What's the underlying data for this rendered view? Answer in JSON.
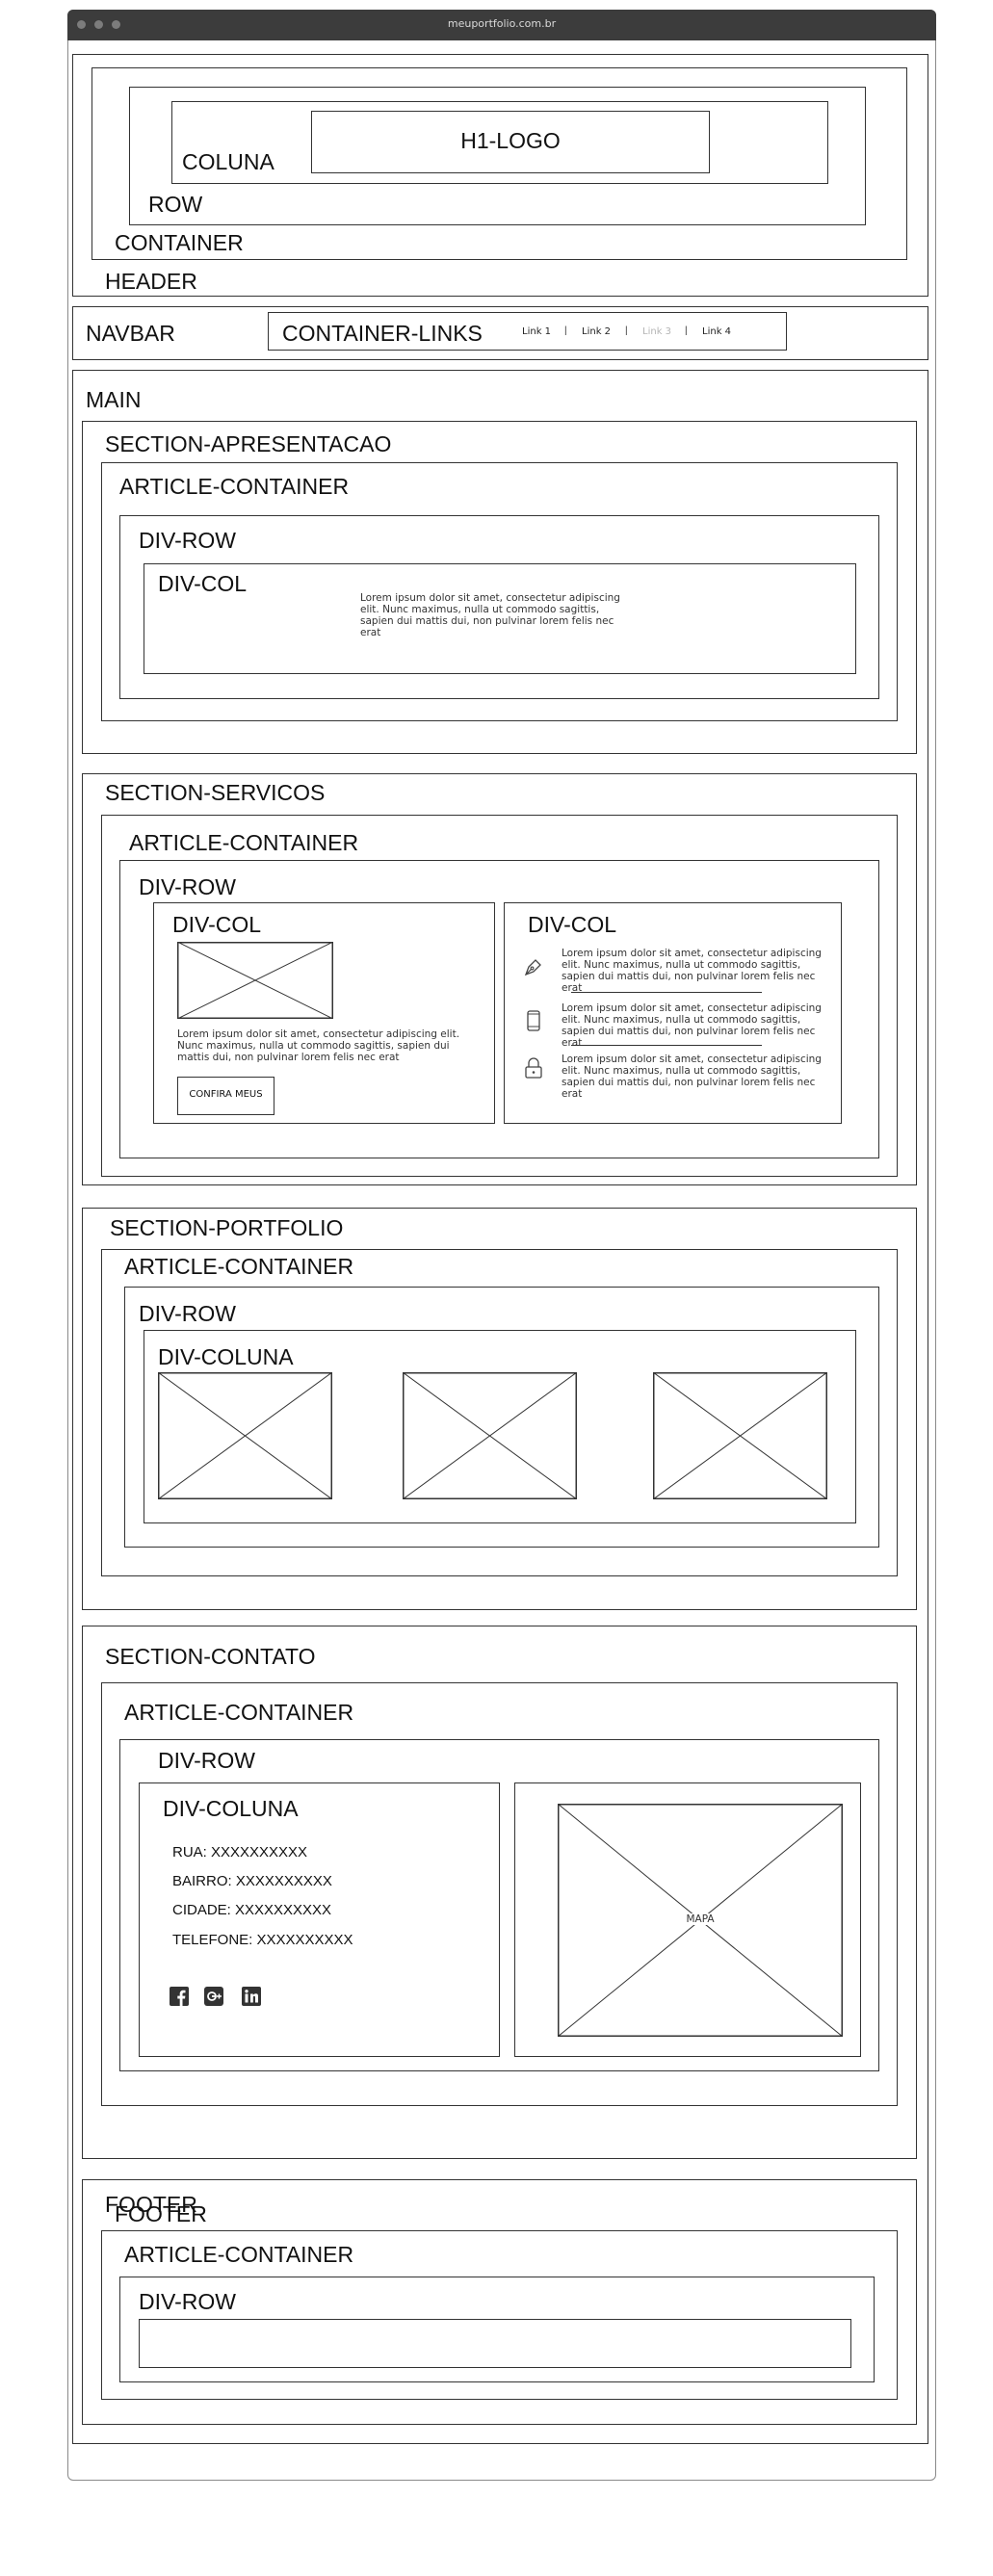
{
  "browser": {
    "url": "meuportfolio.com.br"
  },
  "header": {
    "logo": "H1-LOGO",
    "coluna_label": "COLUNA",
    "row_label": "ROW",
    "container_label": "CONTAINER",
    "header_label": "HEADER"
  },
  "navbar": {
    "label": "NAVBAR",
    "container_label": "CONTAINER-LINKS",
    "links": [
      "Link 1",
      "Link 2",
      "Link 3",
      "Link 4"
    ],
    "separator": "|",
    "disabled_link_color": "#b5b5b5"
  },
  "main": {
    "label": "MAIN",
    "apresentacao": {
      "section_label": "SECTION-APRESENTACAO",
      "article_label": "ARTICLE-CONTAINER",
      "row_label": "DIV-ROW",
      "col_label": "DIV-COL",
      "text": "Lorem ipsum dolor sit amet, consectetur adipiscing elit. Nunc maximus, nulla ut commodo sagittis, sapien dui mattis dui, non pulvinar lorem felis nec erat"
    },
    "servicos": {
      "section_label": "SECTION-SERVICOS",
      "article_label": "ARTICLE-CONTAINER",
      "row_label": "DIV-ROW",
      "col1_label": "DIV-COL",
      "col1_text": "Lorem ipsum dolor sit amet, consectetur adipiscing elit. Nunc maximus, nulla ut commodo sagittis, sapien dui mattis dui, non pulvinar lorem felis nec erat",
      "button_label": "CONFIRA MEUS",
      "col2_label": "DIV-COL",
      "items": [
        {
          "icon": "pen-icon",
          "text": "Lorem ipsum dolor sit amet, consectetur adipiscing elit. Nunc maximus, nulla ut commodo sagittis, sapien dui mattis dui, non pulvinar lorem felis nec erat"
        },
        {
          "icon": "phone-icon",
          "text": "Lorem ipsum dolor sit amet, consectetur adipiscing elit. Nunc maximus, nulla ut commodo sagittis, sapien dui mattis dui, non pulvinar lorem felis nec erat"
        },
        {
          "icon": "lock-icon",
          "text": "Lorem ipsum dolor sit amet, consectetur adipiscing elit. Nunc maximus, nulla ut commodo sagittis, sapien dui mattis dui, non pulvinar lorem felis nec erat"
        }
      ]
    },
    "portfolio": {
      "section_label": "SECTION-PORTFOLIO",
      "article_label": "ARTICLE-CONTAINER",
      "row_label": "DIV-ROW",
      "col_label": "DIV-COLUNA"
    },
    "contato": {
      "section_label": "SECTION-CONTATO",
      "article_label": "ARTICLE-CONTAINER",
      "row_label": "DIV-ROW",
      "col_label": "DIV-COLUNA",
      "rua": "RUA: XXXXXXXXXX",
      "bairro": "BAIRRO: XXXXXXXXXX",
      "cidade": "CIDADE: XXXXXXXXXX",
      "telefone": "TELEFONE: XXXXXXXXXX",
      "map_label": "MAPA",
      "social_icons": [
        "facebook-icon",
        "google-plus-icon",
        "linkedin-icon"
      ]
    }
  },
  "footer": {
    "label": "FOOTER",
    "article_label": "ARTICLE-CONTAINER",
    "row_label": "DIV-ROW"
  }
}
